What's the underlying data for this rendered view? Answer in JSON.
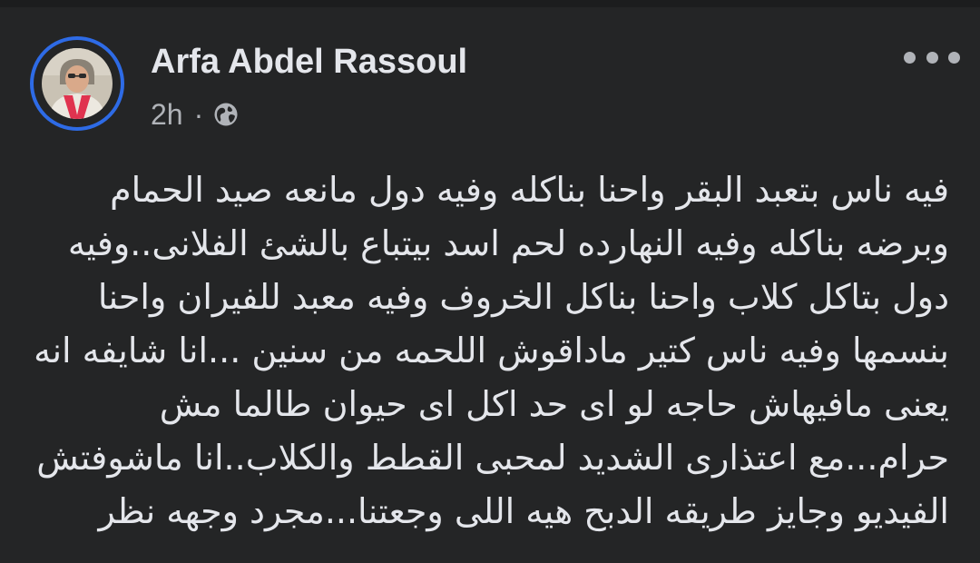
{
  "post": {
    "author_name": "Arfa Abdel Rassoul",
    "time": "2h",
    "separator": "·",
    "privacy_icon": "globe-icon",
    "more_icon": "more-options-icon",
    "text_lines": [
      "فيه ناس بتعبد البقر واحنا بناكله وفيه دول مانعه صيد الحمام",
      "وبرضه بناكله وفيه النهارده لحم اسد بيتباع بالشئ الفلانى..وفيه",
      "دول بتاكل كلاب واحنا بناكل الخروف وفيه معبد للفيران واحنا",
      "بنسمها وفيه ناس كتير ماداقوش اللحمه من سنين ...انا شايفه انه",
      "يعنى مافيهاش حاجه لو اى حد اكل اى حيوان طالما مش",
      "حرام...مع اعتذارى الشديد لمحبى القطط والكلاب..انا ماشوفتش",
      "الفيديو وجايز طريقه الدبح هيه اللى وجعتنا...مجرد وجهه نظر"
    ]
  },
  "colors": {
    "background": "#242526",
    "text_primary": "#e4e6eb",
    "text_secondary": "#b0b3b8",
    "avatar_ring": "#2e6be6"
  }
}
